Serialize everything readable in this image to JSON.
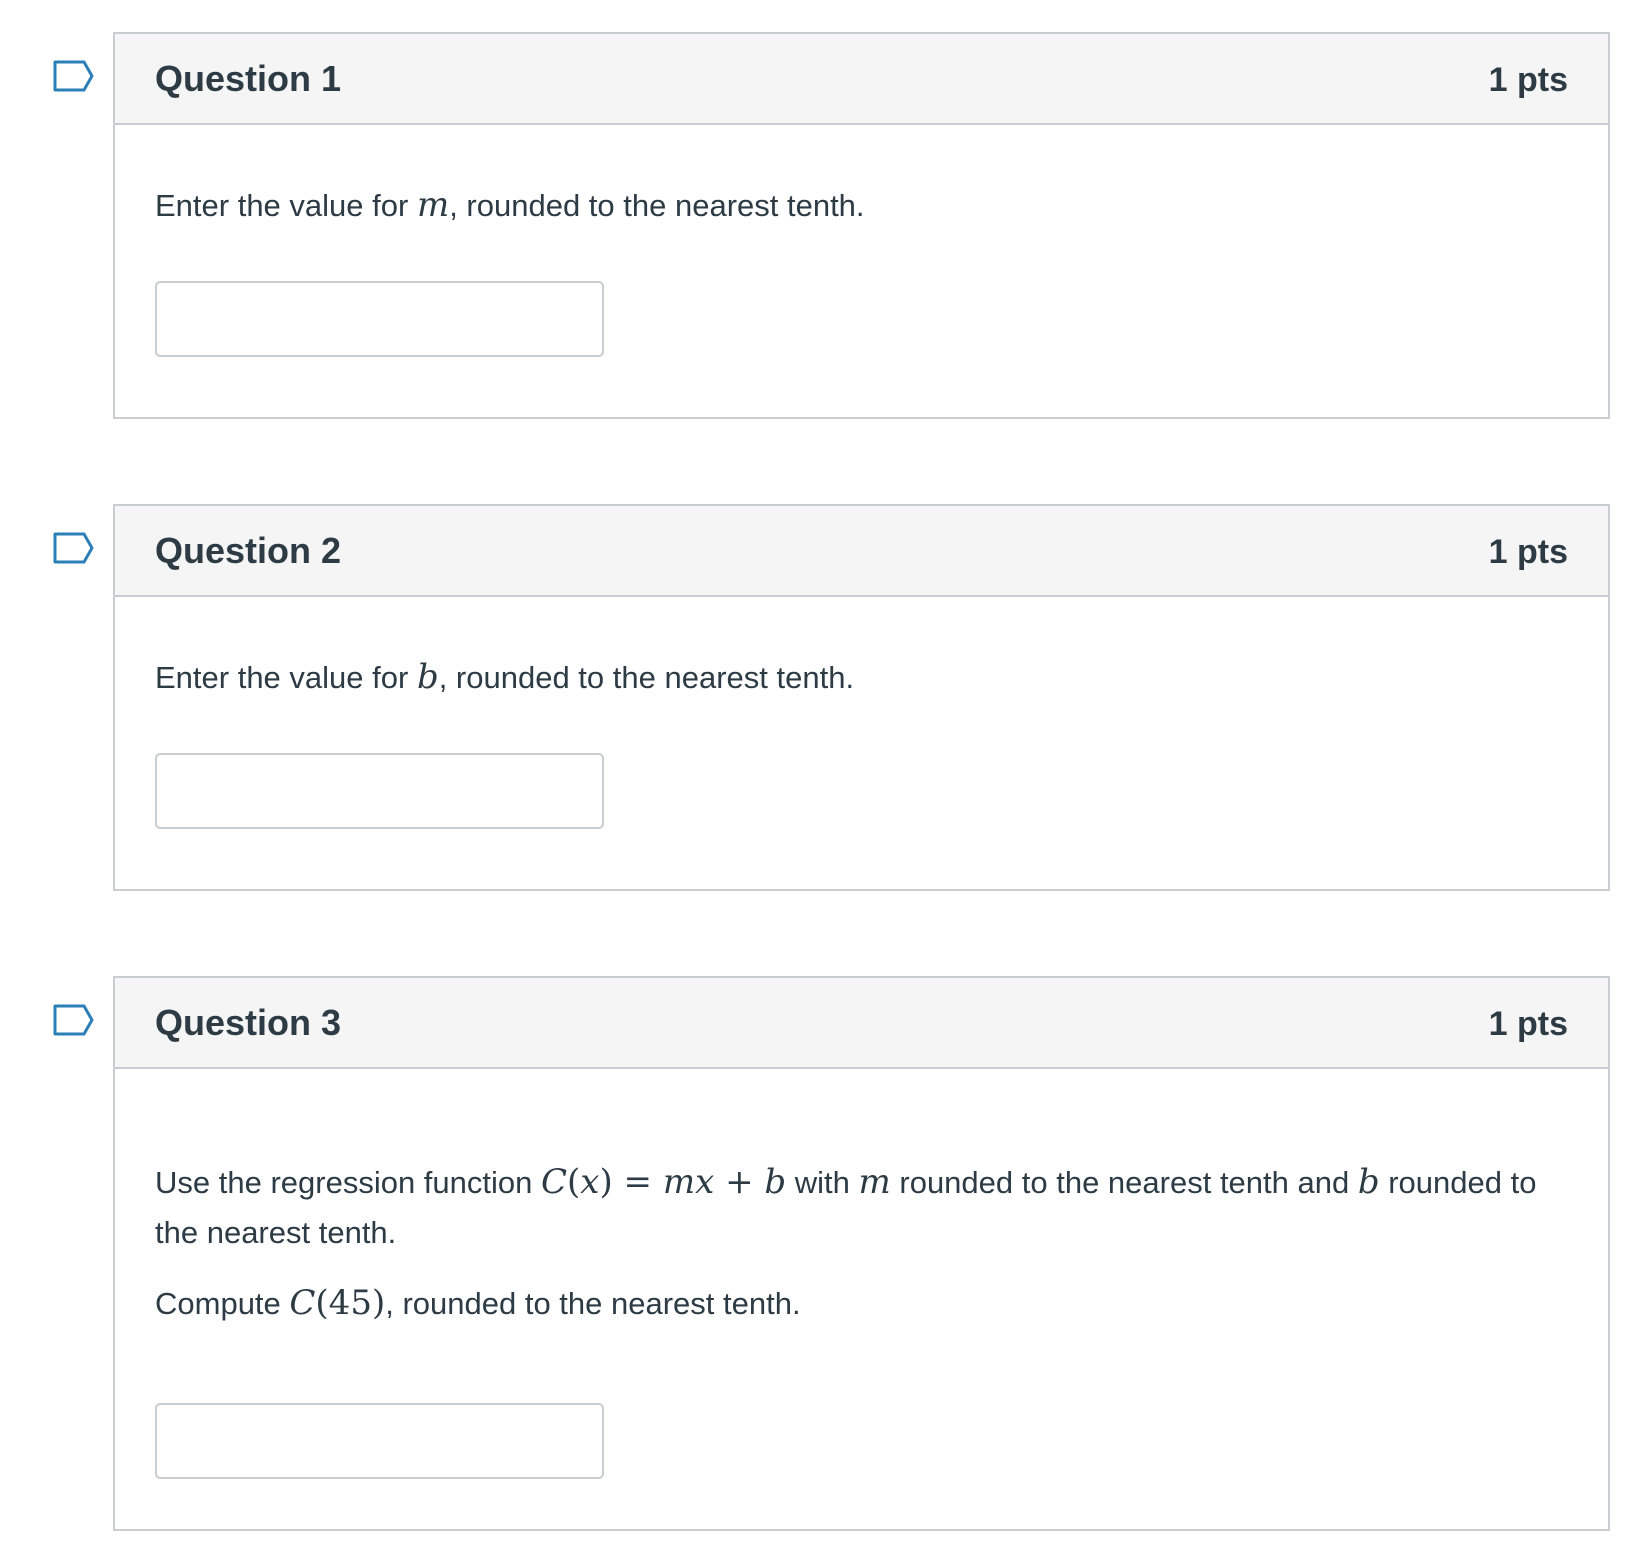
{
  "questions": [
    {
      "title": "Question 1",
      "points": "1 pts",
      "prompt_before": "Enter the value for ",
      "var": "m",
      "prompt_after": ", rounded to the nearest tenth.",
      "answer_value": ""
    },
    {
      "title": "Question 2",
      "points": "1 pts",
      "prompt_before": "Enter the value for ",
      "var": "b",
      "prompt_after": ", rounded to the nearest tenth.",
      "answer_value": ""
    },
    {
      "title": "Question 3",
      "points": "1 pts",
      "line1_a": "Use the regression function ",
      "func_name": "C",
      "func_open": "(",
      "func_var": "x",
      "func_close": ")",
      "equals": " = ",
      "rhs_m": "m",
      "rhs_x": "x",
      "plus": " + ",
      "rhs_b": "b",
      "line1_b": " with ",
      "with_m": "m",
      "line1_c": " rounded to the nearest tenth and ",
      "with_b": "b",
      "line1_d": " rounded to the nearest tenth.",
      "line2_a": "Compute ",
      "compute_func": "C",
      "compute_arg": "(45)",
      "line2_b": ", rounded to the nearest tenth.",
      "answer_value": ""
    }
  ],
  "icons": {
    "flag": "bookmark-flag-icon",
    "flag_color": "#2d7fb8"
  },
  "colors": {
    "header_bg": "#f5f5f5",
    "border": "#c7cdd1",
    "text": "#2d3b45"
  }
}
